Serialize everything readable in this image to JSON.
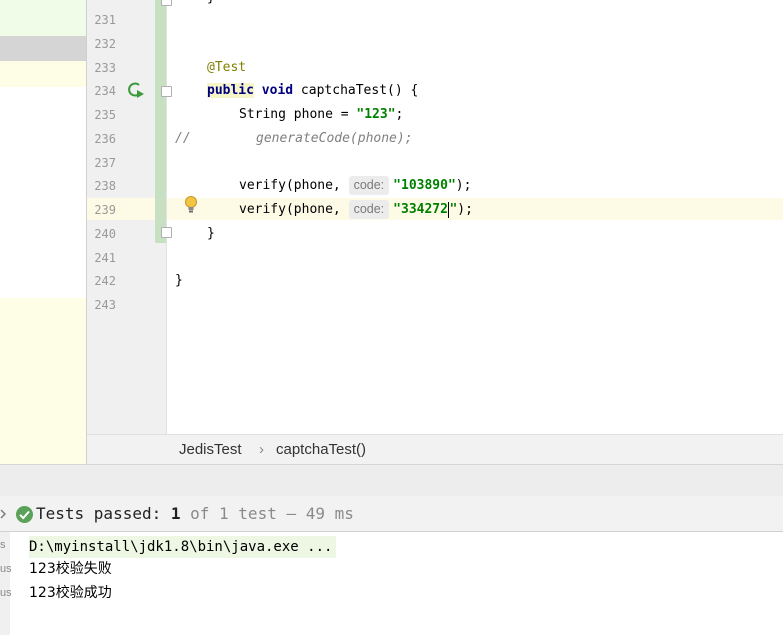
{
  "editor": {
    "line_numbers": [
      "231",
      "232",
      "233",
      "234",
      "235",
      "236",
      "237",
      "238",
      "239",
      "240",
      "241",
      "242",
      "243"
    ],
    "lines": {
      "l233_annotation": "@Test",
      "l234_kw1": "public",
      "l234_kw2": "void",
      "l234_sig": " captchaTest() {",
      "l235_code": "String phone = ",
      "l235_str": "\"123\"",
      "l235_end": ";",
      "l236_comment_prefix": "//",
      "l236_comment_body": "generateCode(phone);",
      "l238_call": "verify(phone,",
      "l238_hint": "code:",
      "l238_str": "\"103890\"",
      "l238_end": ");",
      "l239_call": "verify(phone,",
      "l239_hint": "code:",
      "l239_str_a": "\"334272",
      "l239_str_b": "\"",
      "l239_end": ");",
      "l240_brace": "}",
      "l242_brace": "}",
      "top_brace": "}"
    },
    "run_icon": "run-gutter-icon",
    "intention_icon": "lightbulb-icon"
  },
  "breadcrumb": {
    "class_name": "JedisTest",
    "separator": "›",
    "method_name": "captchaTest()"
  },
  "test_bar": {
    "status_icon": "check-circle-icon",
    "passed_label": "Tests passed: ",
    "passed_count": "1",
    "detail": " of 1 test – 49 ms"
  },
  "console": {
    "gutter_labels": [
      "s",
      "us",
      "us"
    ],
    "command": "D:\\myinstall\\jdk1.8\\bin\\java.exe ...",
    "output": [
      "123校验失败",
      "123校验成功"
    ]
  },
  "colors": {
    "keyword": "#000080",
    "string": "#008000",
    "annotation": "#808000",
    "comment": "#808080",
    "pass_green": "#5aa15a"
  }
}
